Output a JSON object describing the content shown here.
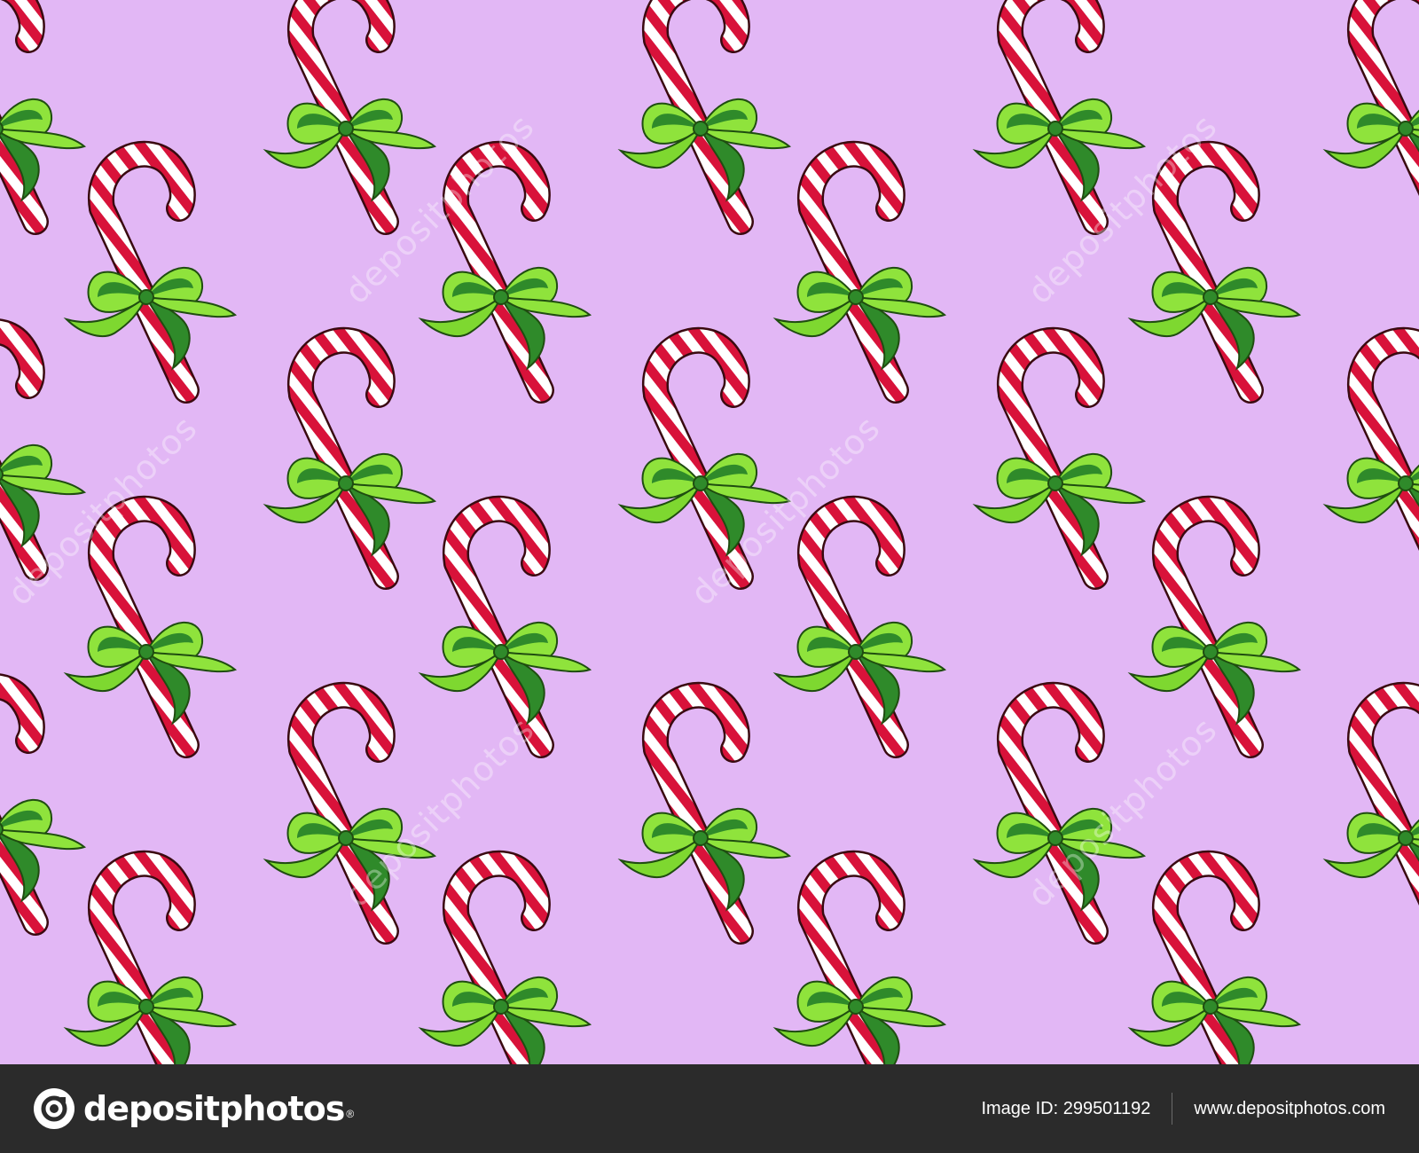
{
  "artwork": {
    "background": "#e2b7f5",
    "motif": "candy-cane-with-green-bow",
    "cane_red": "#d8123a",
    "cane_white": "#ffffff",
    "bow_light": "#8fe33c",
    "bow_dark": "#1f6b1f",
    "watermark_text": "depositphotos"
  },
  "footer": {
    "brand_name": "depositphotos",
    "trademark": "®",
    "image_id_text": "Image ID: 299501192",
    "site_url": "www.depositphotos.com",
    "background": "#2b2b2b"
  }
}
